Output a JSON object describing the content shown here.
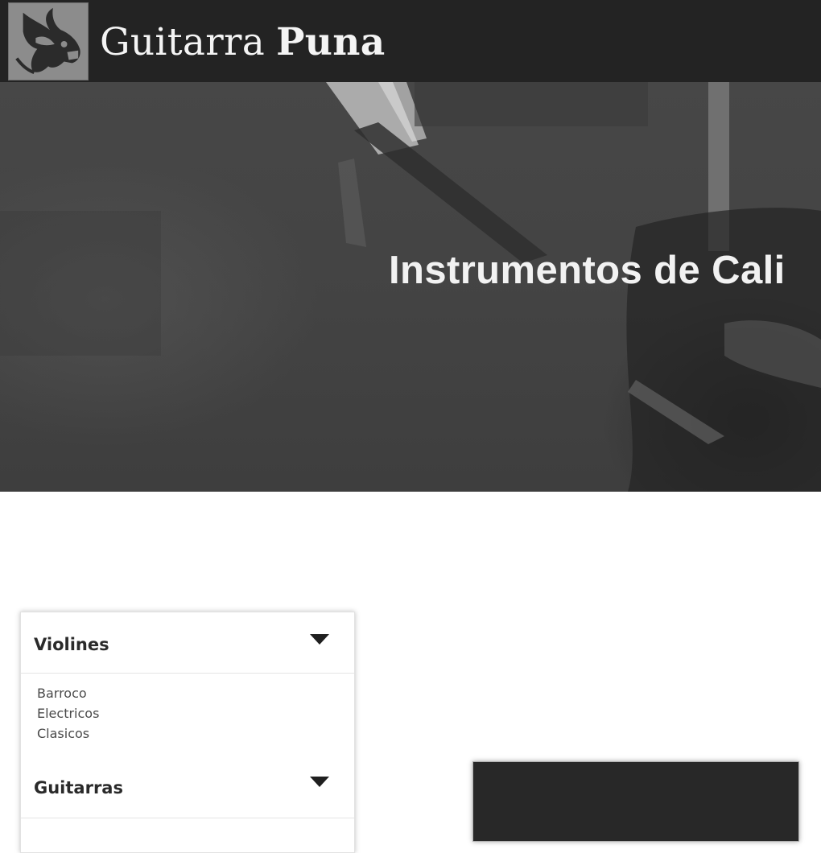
{
  "header": {
    "logo_icon": "goat-head-icon",
    "brand_light": "Guitarra",
    "brand_bold": "Puna"
  },
  "hero": {
    "title": "Instrumentos de Cali"
  },
  "menu": {
    "sections": [
      {
        "label": "Violines",
        "icon": "caret-down-icon",
        "items": [
          "Barroco",
          "Electricos",
          "Clasicos"
        ]
      },
      {
        "label": "Guitarras",
        "icon": "caret-down-icon",
        "items": []
      }
    ]
  },
  "colors": {
    "header_bg": "#232323",
    "hero_bg": "#444444",
    "text_dark": "#2a2a2a",
    "card_dark": "#282828"
  }
}
